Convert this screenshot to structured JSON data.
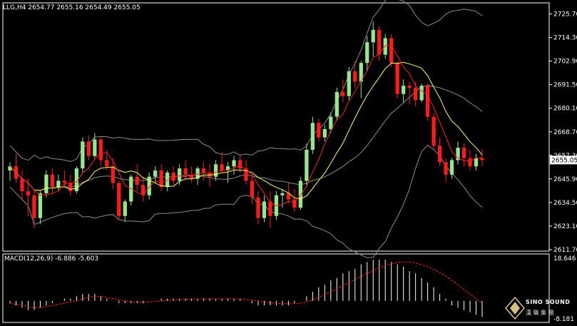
{
  "header": {
    "symbol": "LLG,H4",
    "open": "2654.77",
    "high": "2655.16",
    "low": "2654.49",
    "close": "2655.05"
  },
  "price_axis": {
    "labels": [
      "2725.70",
      "2714.30",
      "2702.90",
      "2691.50",
      "2680.10",
      "2668.70",
      "2657.30",
      "2645.90",
      "2634.50",
      "2623.10",
      "2611.70"
    ],
    "current_price": "2655.05"
  },
  "macd": {
    "label": "MACD(12,26,9)",
    "main": "-6.886",
    "signal": "-5.603",
    "axis_top": "18.646",
    "axis_bottom": "-8.181"
  },
  "watermark": {
    "line1": "SINO SOUND",
    "line2": "漢 聲 集 團"
  },
  "colors": {
    "background": "#000000",
    "up_candle": "#98e68c",
    "down_candle": "#ff1a1a",
    "ma_fast": "#ff2020",
    "ma_slow": "#ffff66",
    "bollinger": "#8c8c8c",
    "macd_hist": "#ffffff",
    "macd_signal": "#ff2020",
    "grid_text": "#ffffff"
  },
  "chart_data": {
    "type": "candlestick",
    "ylim": [
      2611.7,
      2729
    ],
    "candles": [
      [
        2650,
        2654,
        2645,
        2652
      ],
      [
        2652,
        2658,
        2644,
        2646
      ],
      [
        2646,
        2650,
        2636,
        2640
      ],
      [
        2640,
        2646,
        2628,
        2638
      ],
      [
        2638,
        2641,
        2622,
        2627
      ],
      [
        2627,
        2640,
        2624,
        2639
      ],
      [
        2639,
        2650,
        2637,
        2648
      ],
      [
        2648,
        2651,
        2639,
        2642
      ],
      [
        2642,
        2648,
        2640,
        2645
      ],
      [
        2645,
        2650,
        2642,
        2644
      ],
      [
        2644,
        2648,
        2638,
        2640
      ],
      [
        2640,
        2652,
        2639,
        2651
      ],
      [
        2651,
        2666,
        2649,
        2664
      ],
      [
        2664,
        2667,
        2655,
        2657
      ],
      [
        2657,
        2668,
        2656,
        2665
      ],
      [
        2665,
        2666,
        2652,
        2655
      ],
      [
        2655,
        2660,
        2650,
        2652
      ],
      [
        2652,
        2656,
        2641,
        2644
      ],
      [
        2644,
        2645,
        2626,
        2628
      ],
      [
        2628,
        2636,
        2625,
        2635
      ],
      [
        2635,
        2648,
        2633,
        2647
      ],
      [
        2647,
        2653,
        2640,
        2643
      ],
      [
        2643,
        2647,
        2635,
        2638
      ],
      [
        2638,
        2649,
        2636,
        2647
      ],
      [
        2647,
        2652,
        2644,
        2650
      ],
      [
        2650,
        2653,
        2640,
        2642
      ],
      [
        2642,
        2650,
        2640,
        2649
      ],
      [
        2649,
        2652,
        2643,
        2645
      ],
      [
        2645,
        2653,
        2643,
        2651
      ],
      [
        2651,
        2655,
        2645,
        2648
      ],
      [
        2648,
        2652,
        2644,
        2646
      ],
      [
        2646,
        2652,
        2643,
        2651
      ],
      [
        2651,
        2654,
        2645,
        2649
      ],
      [
        2649,
        2653,
        2642,
        2647
      ],
      [
        2647,
        2655,
        2645,
        2653
      ],
      [
        2653,
        2659,
        2649,
        2650
      ],
      [
        2650,
        2654,
        2644,
        2652
      ],
      [
        2652,
        2657,
        2648,
        2655
      ],
      [
        2655,
        2658,
        2649,
        2651
      ],
      [
        2651,
        2655,
        2643,
        2645
      ],
      [
        2645,
        2648,
        2634,
        2637
      ],
      [
        2637,
        2640,
        2624,
        2627
      ],
      [
        2627,
        2638,
        2625,
        2635
      ],
      [
        2635,
        2640,
        2622,
        2628
      ],
      [
        2628,
        2640,
        2626,
        2638
      ],
      [
        2638,
        2641,
        2632,
        2639
      ],
      [
        2639,
        2644,
        2634,
        2636
      ],
      [
        2636,
        2641,
        2630,
        2632
      ],
      [
        2632,
        2647,
        2631,
        2645
      ],
      [
        2645,
        2663,
        2643,
        2660
      ],
      [
        2660,
        2676,
        2658,
        2673
      ],
      [
        2673,
        2675,
        2664,
        2666
      ],
      [
        2666,
        2672,
        2664,
        2670
      ],
      [
        2670,
        2678,
        2668,
        2676
      ],
      [
        2676,
        2690,
        2674,
        2688
      ],
      [
        2688,
        2694,
        2683,
        2686
      ],
      [
        2686,
        2700,
        2684,
        2698
      ],
      [
        2698,
        2703,
        2690,
        2693
      ],
      [
        2693,
        2703,
        2685,
        2702
      ],
      [
        2702,
        2715,
        2698,
        2712
      ],
      [
        2712,
        2722,
        2705,
        2718
      ],
      [
        2718,
        2720,
        2703,
        2706
      ],
      [
        2706,
        2716,
        2704,
        2714
      ],
      [
        2714,
        2716,
        2700,
        2702
      ],
      [
        2702,
        2703,
        2685,
        2687
      ],
      [
        2687,
        2694,
        2683,
        2691
      ],
      [
        2691,
        2693,
        2682,
        2690
      ],
      [
        2690,
        2693,
        2681,
        2684
      ],
      [
        2684,
        2692,
        2683,
        2691
      ],
      [
        2691,
        2692,
        2674,
        2676
      ],
      [
        2676,
        2678,
        2660,
        2662
      ],
      [
        2662,
        2666,
        2652,
        2654
      ],
      [
        2654,
        2656,
        2644,
        2648
      ],
      [
        2648,
        2656,
        2646,
        2655
      ],
      [
        2655,
        2664,
        2653,
        2661
      ],
      [
        2661,
        2663,
        2652,
        2656
      ],
      [
        2656,
        2660,
        2650,
        2652
      ],
      [
        2652,
        2658,
        2650,
        2656
      ],
      [
        2656,
        2660,
        2652,
        2655
      ]
    ],
    "macd_hist": [
      -1,
      -2,
      -3,
      -4,
      -4,
      -3,
      -2,
      -1,
      0,
      1,
      1,
      2,
      3,
      3,
      3,
      2,
      1,
      0,
      -1,
      -1,
      -1,
      -1,
      -1,
      0,
      0,
      1,
      1,
      1,
      1,
      1,
      1,
      1,
      1,
      1,
      1,
      1,
      1,
      1,
      1,
      0,
      -1,
      -2,
      -2,
      -2,
      -2,
      -2,
      -2,
      -1,
      0,
      2,
      4,
      6,
      7,
      9,
      10,
      12,
      13,
      14,
      16,
      17,
      18,
      18,
      18,
      17,
      16,
      15,
      13,
      12,
      10,
      8,
      6,
      3,
      1,
      -2,
      -3,
      -4,
      -5,
      -6,
      -7
    ],
    "macd_signal": [
      -1,
      -1.5,
      -2,
      -2.5,
      -3,
      -3,
      -2.5,
      -2,
      -1.5,
      -1,
      -0.5,
      0,
      1,
      1.5,
      2,
      2,
      1.5,
      1,
      0.5,
      0,
      -0.3,
      -0.5,
      -0.6,
      -0.5,
      -0.3,
      0,
      0.2,
      0.4,
      0.6,
      0.7,
      0.8,
      0.8,
      0.9,
      0.9,
      0.9,
      0.9,
      0.9,
      0.9,
      0.8,
      0.6,
      0.3,
      0,
      -0.4,
      -0.8,
      -1,
      -1.2,
      -1.3,
      -1.2,
      -1,
      -0.5,
      0.5,
      1.5,
      2.7,
      4,
      5.3,
      6.7,
      8,
      9.4,
      10.8,
      12,
      13.3,
      14.5,
      15.5,
      16.3,
      16.8,
      17,
      17,
      16.5,
      15.8,
      15,
      13.8,
      12.4,
      10.8,
      9,
      7,
      5,
      3,
      1,
      -1
    ]
  }
}
